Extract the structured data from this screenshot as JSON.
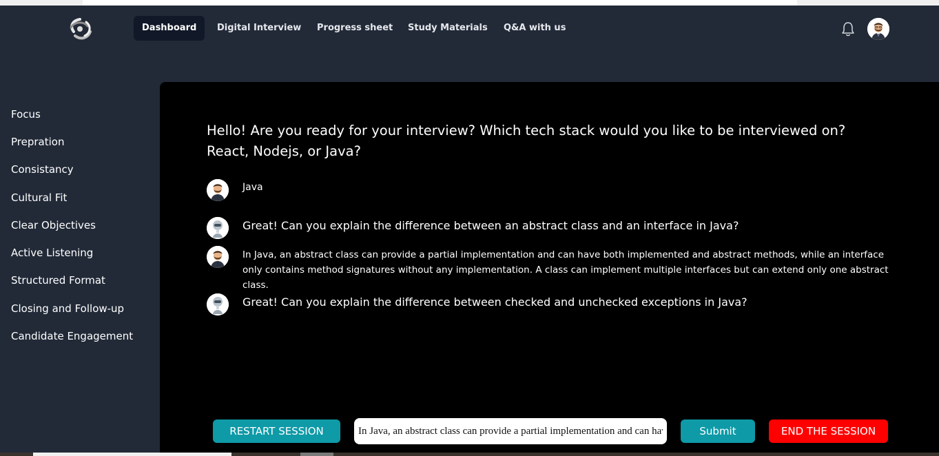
{
  "nav": {
    "items": [
      {
        "label": "Dashboard",
        "active": true
      },
      {
        "label": "Digital Interview",
        "active": false
      },
      {
        "label": "Progress sheet",
        "active": false
      },
      {
        "label": "Study Materials",
        "active": false
      },
      {
        "label": "Q&A with us",
        "active": false
      }
    ],
    "icons": {
      "logo": "swirl-logo-icon",
      "notifications": "bell-icon",
      "profile": "user-avatar"
    }
  },
  "sidebar": {
    "items": [
      {
        "label": "Focus"
      },
      {
        "label": "Prepration"
      },
      {
        "label": "Consistancy"
      },
      {
        "label": "Cultural Fit"
      },
      {
        "label": "Clear Objectives"
      },
      {
        "label": "Active Listening"
      },
      {
        "label": "Structured Format"
      },
      {
        "label": "Closing and Follow-up"
      },
      {
        "label": "Candidate Engagement"
      }
    ]
  },
  "chat": {
    "greeting": "Hello! Are you ready for your interview? Which tech stack would you like to be interviewed on? React, Nodejs, or Java?",
    "messages": [
      {
        "sender": "user",
        "avatar": "user-avatar",
        "text": "Java"
      },
      {
        "sender": "bot",
        "avatar": "robot-avatar",
        "text": "Great! Can you explain the difference between an abstract class and an interface in Java?"
      },
      {
        "sender": "user",
        "avatar": "user-avatar",
        "text": "In Java, an abstract class can provide a partial implementation and can have both implemented and abstract methods, while an interface only contains method signatures without any implementation. A class can implement multiple interfaces but can extend only one abstract class."
      },
      {
        "sender": "bot",
        "avatar": "robot-avatar",
        "text": "Great! Can you explain the difference between checked and unchecked exceptions in Java?"
      }
    ]
  },
  "controls": {
    "restart_label": "RESTART SESSION",
    "answer_value": "In Java, an abstract class can provide a partial implementation and can have both implemented and abstract methods, while an interface only contains method signatures without any implementation. A class can implement multiple interfaces but can extend only one abstract class.",
    "submit_label": "Submit",
    "end_label": "END THE SESSION"
  },
  "colors": {
    "navbar_bg": "#222a38",
    "main_bg": "#000000",
    "active_nav_bg": "#111827",
    "teal": "#0e9aa7",
    "danger": "#ff0000"
  }
}
